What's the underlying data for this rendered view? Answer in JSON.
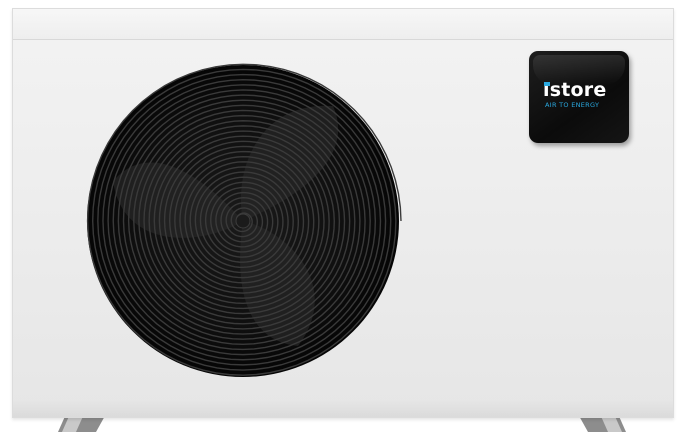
{
  "product": {
    "logo": {
      "brand": "store",
      "brand_prefix": "i",
      "tagline": "AIR TO ENERGY",
      "accent_color": "#2aa9e0"
    },
    "body_color": "#ededed",
    "panel_color": "#111111",
    "fan_color": "#0d0d0d"
  }
}
